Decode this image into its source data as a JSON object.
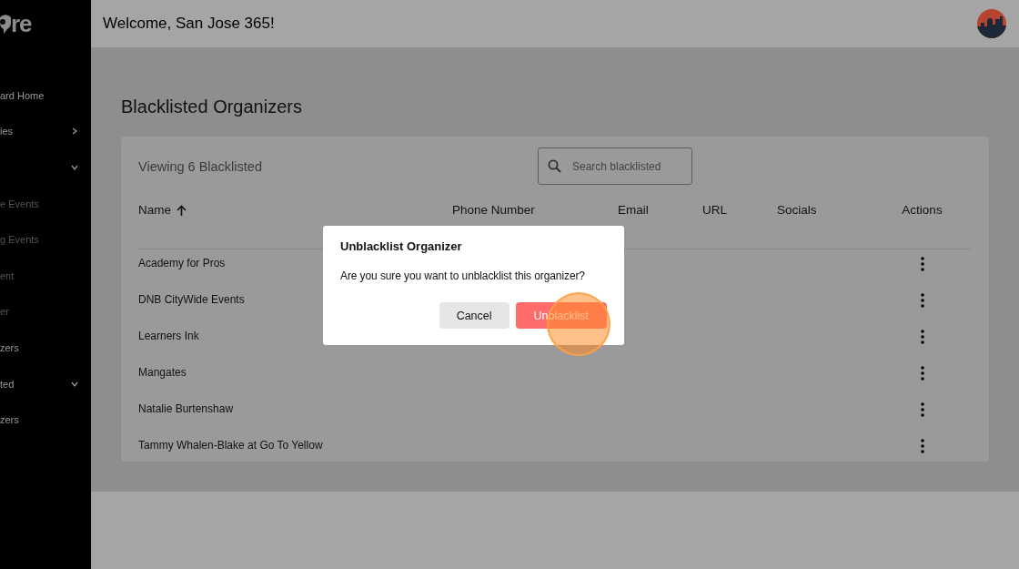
{
  "sidebar": {
    "logo": "re",
    "items": [
      {
        "label": "ard Home",
        "kind": "link",
        "dim": false
      },
      {
        "label": "ies",
        "kind": "collapsed",
        "dim": false
      },
      {
        "kind": "expanded"
      },
      {
        "label": "e Events",
        "kind": "link",
        "dim": true
      },
      {
        "label": "g Events",
        "kind": "link",
        "dim": true
      },
      {
        "label": "ent",
        "kind": "link",
        "dim": true
      },
      {
        "label": "er",
        "kind": "link",
        "dim": true
      },
      {
        "label": "zers",
        "kind": "link",
        "dim": false
      },
      {
        "label": "ted",
        "kind": "expanded",
        "dim": false
      },
      {
        "label": "zers",
        "kind": "link",
        "dim": false
      }
    ]
  },
  "header": {
    "greeting": "Welcome, San Jose 365!"
  },
  "page": {
    "title": "Blacklisted Organizers"
  },
  "card": {
    "count_text": "Viewing 6 Blacklisted",
    "search": {
      "placeholder": "Search blacklisted"
    }
  },
  "table": {
    "columns": [
      {
        "label": "Name",
        "sorted": true
      },
      {
        "label": "Phone Number",
        "sorted": false
      },
      {
        "label": "Email",
        "sorted": false
      },
      {
        "label": "URL",
        "sorted": false
      },
      {
        "label": "Socials",
        "sorted": false
      },
      {
        "label": "Actions",
        "sorted": false
      }
    ],
    "rows": [
      {
        "name": "Academy for Pros"
      },
      {
        "name": "DNB CityWide Events"
      },
      {
        "name": "Learners Ink"
      },
      {
        "name": "Mangates"
      },
      {
        "name": "Natalie Burtenshaw"
      },
      {
        "name": "Tammy Whalen-Blake at Go To Yellow"
      }
    ]
  },
  "dialog": {
    "title": "Unblacklist Organizer",
    "message": "Are you sure you want to unblacklist this organizer?",
    "buttons": [
      {
        "label": "Cancel",
        "kind": "secondary"
      },
      {
        "label": "Unblacklist",
        "kind": "danger"
      }
    ]
  }
}
